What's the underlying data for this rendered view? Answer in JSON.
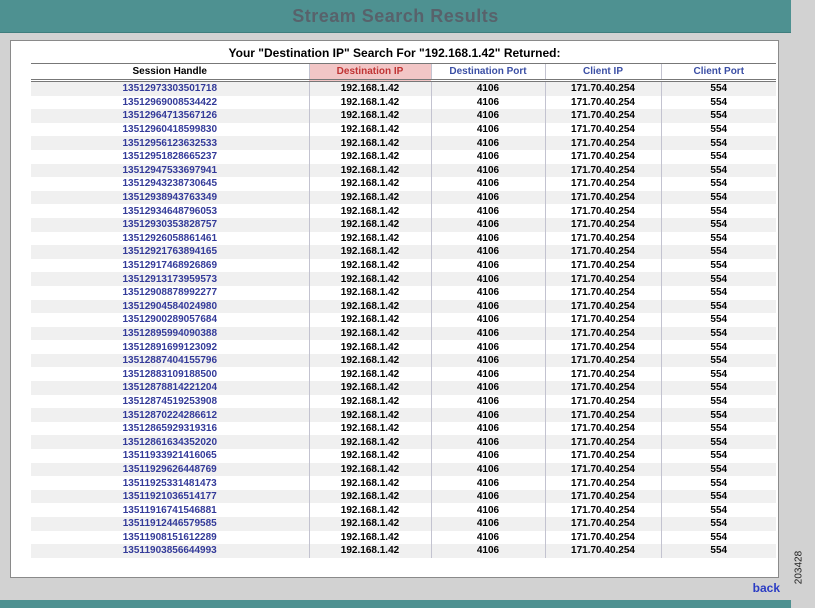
{
  "page": {
    "title": "Stream Search Results",
    "search_summary": "Your \"Destination IP\" Search For \"192.168.1.42\" Returned:",
    "back_label": "back",
    "figure_number": "203428"
  },
  "colors": {
    "header_bar": "#4e9191",
    "header_title_text": "#58626b",
    "highlight_bg": "#f2c6c6",
    "highlight_text": "#c03434",
    "column_header_text": "#3b4fa5",
    "session_link_text": "#333a99",
    "back_link_text": "#2b3cc4"
  },
  "table": {
    "columns": [
      {
        "label": "Session Handle",
        "highlighted": false
      },
      {
        "label": "Destination IP",
        "highlighted": true
      },
      {
        "label": "Destination Port",
        "highlighted": false
      },
      {
        "label": "Client IP",
        "highlighted": false
      },
      {
        "label": "Client Port",
        "highlighted": false
      }
    ],
    "rows": [
      [
        "13512973303501718",
        "192.168.1.42",
        "4106",
        "171.70.40.254",
        "554"
      ],
      [
        "13512969008534422",
        "192.168.1.42",
        "4106",
        "171.70.40.254",
        "554"
      ],
      [
        "13512964713567126",
        "192.168.1.42",
        "4106",
        "171.70.40.254",
        "554"
      ],
      [
        "13512960418599830",
        "192.168.1.42",
        "4106",
        "171.70.40.254",
        "554"
      ],
      [
        "13512956123632533",
        "192.168.1.42",
        "4106",
        "171.70.40.254",
        "554"
      ],
      [
        "13512951828665237",
        "192.168.1.42",
        "4106",
        "171.70.40.254",
        "554"
      ],
      [
        "13512947533697941",
        "192.168.1.42",
        "4106",
        "171.70.40.254",
        "554"
      ],
      [
        "13512943238730645",
        "192.168.1.42",
        "4106",
        "171.70.40.254",
        "554"
      ],
      [
        "13512938943763349",
        "192.168.1.42",
        "4106",
        "171.70.40.254",
        "554"
      ],
      [
        "13512934648796053",
        "192.168.1.42",
        "4106",
        "171.70.40.254",
        "554"
      ],
      [
        "13512930353828757",
        "192.168.1.42",
        "4106",
        "171.70.40.254",
        "554"
      ],
      [
        "13512926058861461",
        "192.168.1.42",
        "4106",
        "171.70.40.254",
        "554"
      ],
      [
        "13512921763894165",
        "192.168.1.42",
        "4106",
        "171.70.40.254",
        "554"
      ],
      [
        "13512917468926869",
        "192.168.1.42",
        "4106",
        "171.70.40.254",
        "554"
      ],
      [
        "13512913173959573",
        "192.168.1.42",
        "4106",
        "171.70.40.254",
        "554"
      ],
      [
        "13512908878992277",
        "192.168.1.42",
        "4106",
        "171.70.40.254",
        "554"
      ],
      [
        "13512904584024980",
        "192.168.1.42",
        "4106",
        "171.70.40.254",
        "554"
      ],
      [
        "13512900289057684",
        "192.168.1.42",
        "4106",
        "171.70.40.254",
        "554"
      ],
      [
        "13512895994090388",
        "192.168.1.42",
        "4106",
        "171.70.40.254",
        "554"
      ],
      [
        "13512891699123092",
        "192.168.1.42",
        "4106",
        "171.70.40.254",
        "554"
      ],
      [
        "13512887404155796",
        "192.168.1.42",
        "4106",
        "171.70.40.254",
        "554"
      ],
      [
        "13512883109188500",
        "192.168.1.42",
        "4106",
        "171.70.40.254",
        "554"
      ],
      [
        "13512878814221204",
        "192.168.1.42",
        "4106",
        "171.70.40.254",
        "554"
      ],
      [
        "13512874519253908",
        "192.168.1.42",
        "4106",
        "171.70.40.254",
        "554"
      ],
      [
        "13512870224286612",
        "192.168.1.42",
        "4106",
        "171.70.40.254",
        "554"
      ],
      [
        "13512865929319316",
        "192.168.1.42",
        "4106",
        "171.70.40.254",
        "554"
      ],
      [
        "13512861634352020",
        "192.168.1.42",
        "4106",
        "171.70.40.254",
        "554"
      ],
      [
        "13511933921416065",
        "192.168.1.42",
        "4106",
        "171.70.40.254",
        "554"
      ],
      [
        "13511929626448769",
        "192.168.1.42",
        "4106",
        "171.70.40.254",
        "554"
      ],
      [
        "13511925331481473",
        "192.168.1.42",
        "4106",
        "171.70.40.254",
        "554"
      ],
      [
        "13511921036514177",
        "192.168.1.42",
        "4106",
        "171.70.40.254",
        "554"
      ],
      [
        "13511916741546881",
        "192.168.1.42",
        "4106",
        "171.70.40.254",
        "554"
      ],
      [
        "13511912446579585",
        "192.168.1.42",
        "4106",
        "171.70.40.254",
        "554"
      ],
      [
        "13511908151612289",
        "192.168.1.42",
        "4106",
        "171.70.40.254",
        "554"
      ],
      [
        "13511903856644993",
        "192.168.1.42",
        "4106",
        "171.70.40.254",
        "554"
      ]
    ]
  }
}
